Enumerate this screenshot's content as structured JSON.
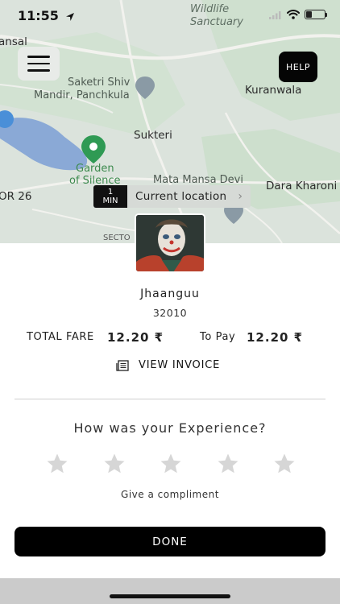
{
  "status_bar": {
    "time": "11:55"
  },
  "map": {
    "labels": {
      "ansal": "ansal",
      "saketri_line1": "Saketri Shiv",
      "saketri_line2": "Mandir, Panchkula",
      "sukteri": "Sukteri",
      "garden_line1": "Garden",
      "garden_line2": "of Silence",
      "mata": "Mata Mansa Devi",
      "dara": "Dara Kharoni",
      "kuranwala": "Kuranwala",
      "wildlife_line1": "Wildlife",
      "wildlife_line2": "Sanctuary",
      "or26": "OR 26",
      "secto": "SECTO"
    },
    "help_label": "HELP",
    "eta_value": "1",
    "eta_unit": "MIN",
    "location_label": "Current location"
  },
  "driver": {
    "name": "Jhaanguu",
    "id": "32010"
  },
  "fare": {
    "total_label": "TOTAL FARE",
    "total_value": "12.20 ₹",
    "to_pay_label": "To Pay",
    "to_pay_value": "12.20 ₹"
  },
  "invoice_label": "VIEW INVOICE",
  "rating": {
    "title": "How was your Experience?",
    "stars_total": 5,
    "stars_selected": 0,
    "compliment_label": "Give a compliment"
  },
  "done_label": "DONE",
  "colors": {
    "accent": "#000000",
    "star_inactive": "#d6d6d6",
    "map_background": "#d9e2da",
    "water": "#8aa9d6"
  },
  "icons": [
    "location-arrow-icon",
    "cellular-icon",
    "wifi-icon",
    "battery-icon",
    "menu-icon",
    "chevron-right-icon",
    "invoice-icon",
    "star-icon"
  ]
}
